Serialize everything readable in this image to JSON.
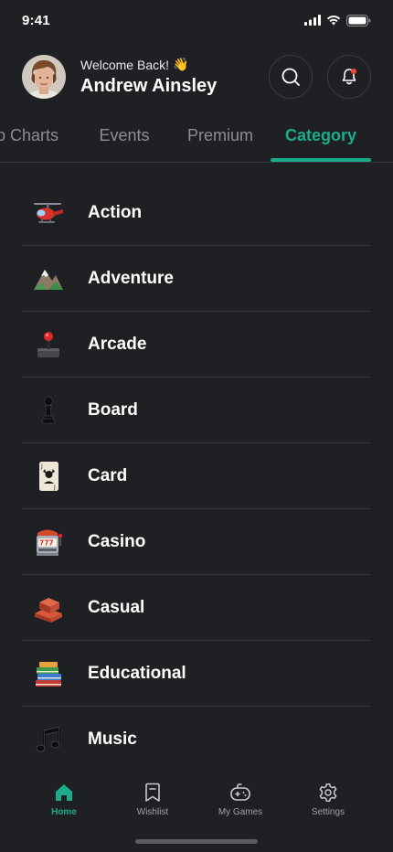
{
  "status_bar": {
    "time": "9:41"
  },
  "header": {
    "welcome": "Welcome Back!",
    "wave_emoji": "👋",
    "user_name": "Andrew Ainsley",
    "search_icon": "search-icon",
    "notification_icon": "bell-icon",
    "notification_dot_color": "#f54336"
  },
  "tabs": [
    {
      "label": "Top Charts",
      "visible_text": "p Charts",
      "active": false
    },
    {
      "label": "Events",
      "active": false
    },
    {
      "label": "Premium",
      "active": false
    },
    {
      "label": "Category",
      "active": true
    }
  ],
  "categories": [
    {
      "label": "Action",
      "icon": "helicopter-icon"
    },
    {
      "label": "Adventure",
      "icon": "mountain-icon"
    },
    {
      "label": "Arcade",
      "icon": "joystick-icon"
    },
    {
      "label": "Board",
      "icon": "chess-pawn-icon"
    },
    {
      "label": "Card",
      "icon": "joker-card-icon"
    },
    {
      "label": "Casino",
      "icon": "slot-machine-icon"
    },
    {
      "label": "Casual",
      "icon": "bricks-icon"
    },
    {
      "label": "Educational",
      "icon": "books-icon"
    },
    {
      "label": "Music",
      "icon": "music-note-icon"
    }
  ],
  "bottom_nav": [
    {
      "label": "Home",
      "icon": "home-icon",
      "active": true
    },
    {
      "label": "Wishlist",
      "icon": "bookmark-icon",
      "active": false
    },
    {
      "label": "My Games",
      "icon": "gamepad-icon",
      "active": false
    },
    {
      "label": "Settings",
      "icon": "gear-icon",
      "active": false
    }
  ],
  "colors": {
    "background": "#1f2024",
    "accent": "#1bac8b",
    "inactive_text": "#8d8e93",
    "divider": "#35363b"
  }
}
